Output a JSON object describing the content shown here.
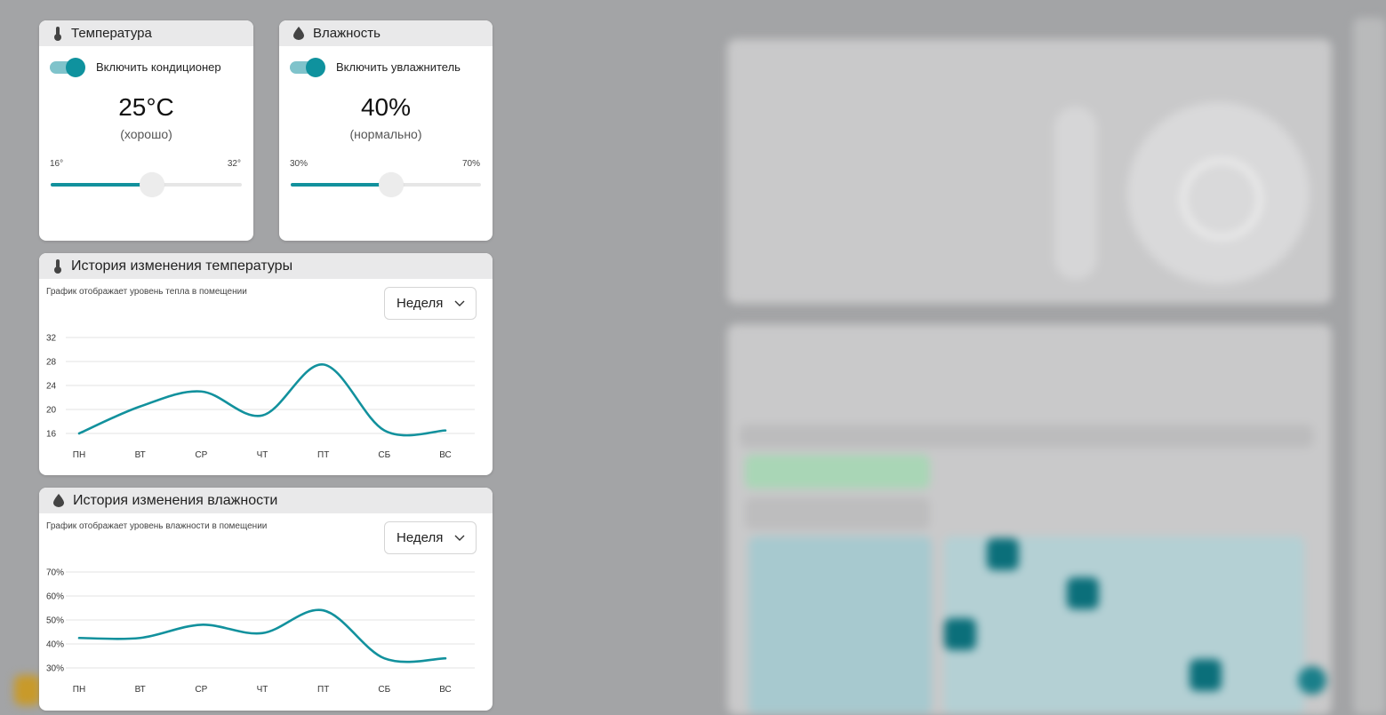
{
  "colors": {
    "accent": "#12919d",
    "grid": "#e3e3e3",
    "header_bg": "#e9e9ea"
  },
  "temperature_card": {
    "title": "Температура",
    "icon": "thermometer-icon",
    "toggle_label": "Включить кондиционер",
    "toggle_on": true,
    "value": "25°C",
    "status": "(хорошо)",
    "min_label": "16°",
    "max_label": "32°",
    "slider_level": 0.53
  },
  "humidity_card": {
    "title": "Влажность",
    "icon": "droplet-icon",
    "toggle_label": "Включить увлажнитель",
    "toggle_on": true,
    "value": "40%",
    "status": "(нормально)",
    "min_label": "30%",
    "max_label": "70%",
    "slider_level": 0.53
  },
  "temp_history": {
    "title": "История изменения температуры",
    "description": "График отображает уровень тепла в помещении",
    "period": "Неделя"
  },
  "humidity_history": {
    "title": "История изменения влажности",
    "description": "График отображает уровень влажности в помещении",
    "period": "Неделя"
  },
  "chart_data": [
    {
      "type": "line",
      "categories": [
        "ПН",
        "ВТ",
        "СР",
        "ЧТ",
        "ПТ",
        "СБ",
        "ВС"
      ],
      "series": [
        {
          "values": [
            16,
            20.5,
            23,
            19,
            27.5,
            16.5,
            16.5
          ]
        }
      ],
      "yticks": [
        "16",
        "20",
        "24",
        "28",
        "32"
      ],
      "ytick_values": [
        16,
        20,
        24,
        28,
        32
      ],
      "ylim": [
        16,
        32
      ],
      "grid": true
    },
    {
      "type": "line",
      "categories": [
        "ПН",
        "ВТ",
        "СР",
        "ЧТ",
        "ПТ",
        "СБ",
        "ВС"
      ],
      "series": [
        {
          "values": [
            42.5,
            42.5,
            48,
            44.5,
            54,
            34,
            34
          ]
        }
      ],
      "yticks": [
        "30%",
        "40%",
        "50%",
        "60%",
        "70%"
      ],
      "ytick_values": [
        30,
        40,
        50,
        60,
        70
      ],
      "ylim": [
        30,
        70
      ],
      "grid": true
    }
  ]
}
